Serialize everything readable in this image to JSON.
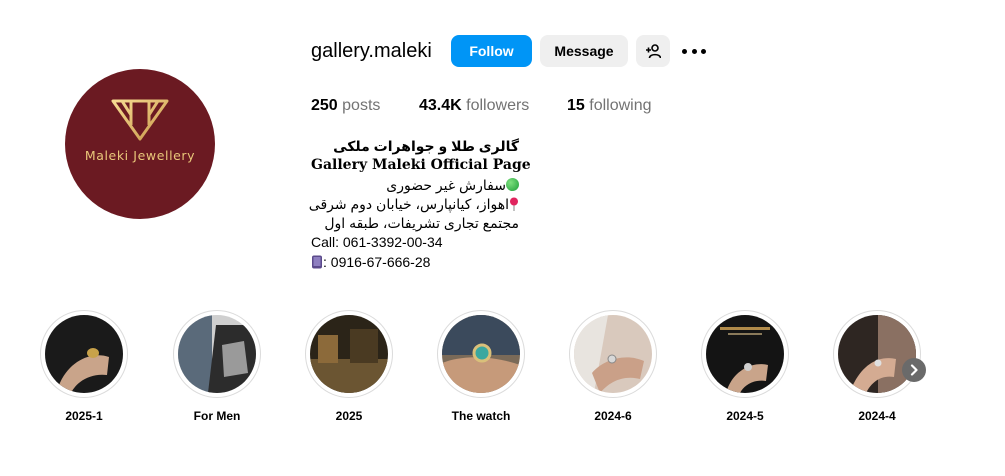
{
  "profile": {
    "username": "gallery.maleki",
    "avatar_text": "Maleki Jewellery",
    "follow_label": "Follow",
    "message_label": "Message",
    "add_user_icon": "person-plus-icon",
    "more_icon": "more-horizontal-icon"
  },
  "stats": {
    "posts_count": "250",
    "posts_label": "posts",
    "followers_count": "43.4K",
    "followers_label": "followers",
    "following_count": "15",
    "following_label": "following"
  },
  "bio": {
    "line1": "گالری طلا و جواهرات ملکی",
    "line2": "Gallery Maleki Official Page",
    "line3": "سفارش غیر حضوری",
    "line4": "اهواز، کیانپارس، خیابان دوم شرقی",
    "line5": "مجتمع تجاری تشریفات، طبقه اول",
    "line6": "Call: 061-3392-00-34",
    "line7": ": 0916-67-666-28"
  },
  "highlights": [
    {
      "label": "2025-1"
    },
    {
      "label": "For Men"
    },
    {
      "label": "2025"
    },
    {
      "label": "The watch"
    },
    {
      "label": "2024-6"
    },
    {
      "label": "2024-5"
    },
    {
      "label": "2024-4"
    }
  ],
  "colors": {
    "accent": "#0095f6",
    "avatar_bg": "#6b1a22",
    "gold": "#e9c77a"
  }
}
